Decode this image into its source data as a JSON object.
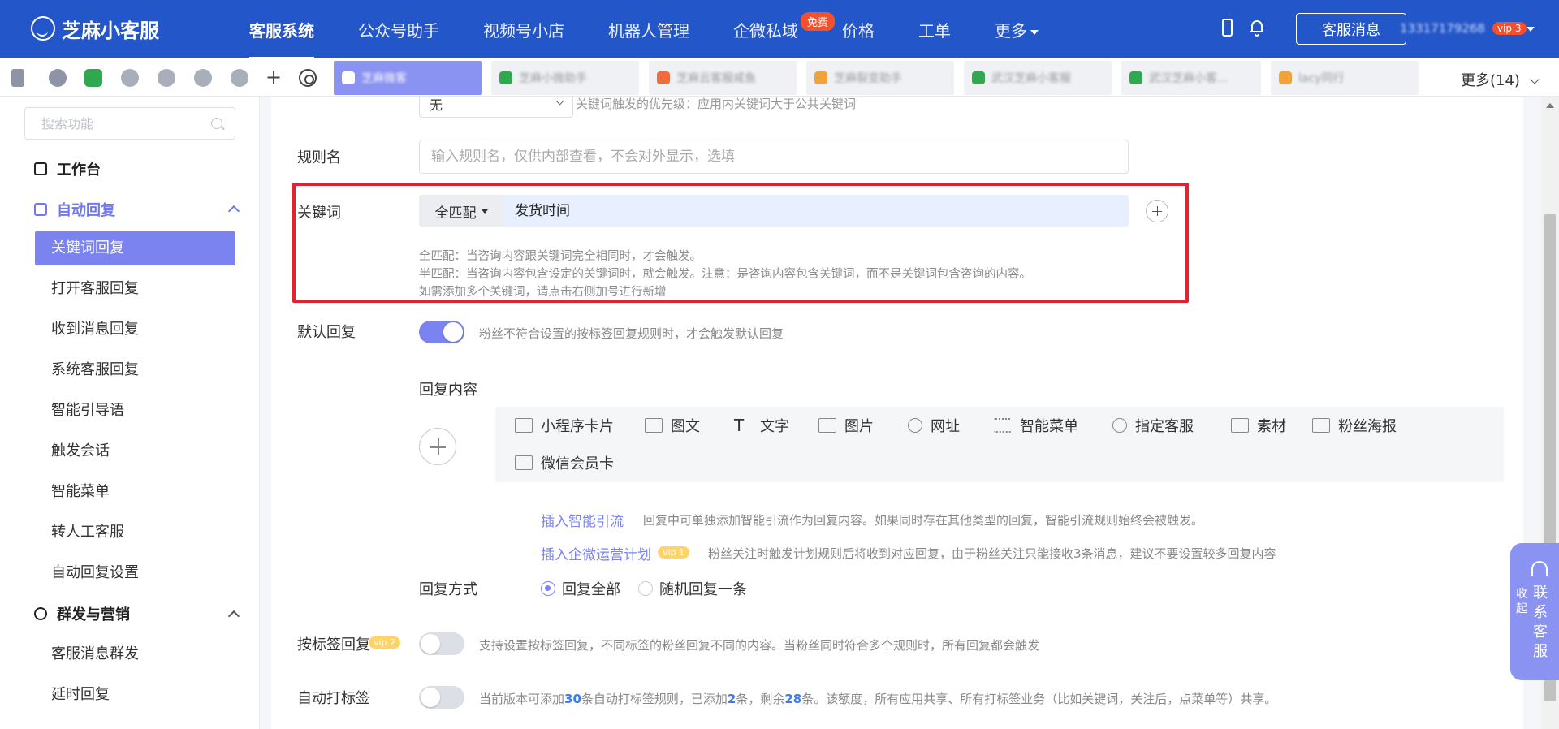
{
  "topbar": {
    "logo": "芝麻小客服",
    "nav": [
      "客服系统",
      "公众号助手",
      "视频号小店",
      "机器人管理",
      "企微私域",
      "价格",
      "工单",
      "更多"
    ],
    "free_badge": "免费",
    "cs_message_button": "客服消息",
    "account": "13317179268",
    "vip_badge": "vip 3",
    "color_primary": "#2356c8"
  },
  "tabs": {
    "items": [
      "芝麻微客",
      "芝麻小微助手",
      "芝麻云客服咸鱼",
      "芝麻裂变助手",
      "武汉芝麻小客服",
      "武汉芝麻小客...",
      "lacy同行"
    ],
    "more": "更多(14)"
  },
  "sidebar": {
    "search_placeholder": "搜索功能",
    "workbench": "工作台",
    "auto_reply": "自动回复",
    "auto_reply_items": [
      "关键词回复",
      "打开客服回复",
      "收到消息回复",
      "系统客服回复",
      "智能引导语",
      "触发会话",
      "智能菜单",
      "转人工客服",
      "自动回复设置"
    ],
    "marketing": "群发与营销",
    "marketing_items": [
      "客服消息群发",
      "延时回复"
    ],
    "active_color": "#7a83f0"
  },
  "form": {
    "top_select_value": "无",
    "top_hint": "关键词触发的优先级：应用内关键词大于公共关键词",
    "rule_name_label": "规则名",
    "rule_name_placeholder": "输入规则名，仅供内部查看，不会对外显示，选填",
    "keyword_label": "关键词",
    "match_type": "全匹配",
    "keyword_value": "发货时间",
    "hints": [
      "全匹配：当咨询内容跟关键词完全相同时，才会触发。",
      "半匹配：当咨询内容包含设定的关键词时，就会触发。注意：是咨询内容包含关键词，而不是关键词包含咨询的内容。",
      "如需添加多个关键词，请点击右侧加号进行新增"
    ],
    "default_reply_label": "默认回复",
    "default_reply_hint": "粉丝不符合设置的按标签回复规则时，才会触发默认回复",
    "reply_content_label": "回复内容",
    "reply_types": [
      "小程序卡片",
      "图文",
      "文字",
      "图片",
      "网址",
      "智能菜单",
      "指定客服",
      "素材",
      "粉丝海报",
      "微信会员卡"
    ],
    "insert_smart_link": "插入智能引流",
    "insert_smart_hint": "回复中可单独添加智能引流作为回复内容。如果同时存在其他类型的回复，智能引流规则始终会被触发。",
    "insert_plan_link": "插入企微运营计划",
    "insert_plan_vip": "vip 1",
    "insert_plan_hint": "粉丝关注时触发计划规则后将收到对应回复，由于粉丝关注只能接收3条消息，建议不要设置较多回复内容",
    "reply_mode_label": "回复方式",
    "reply_mode_options": [
      "回复全部",
      "随机回复一条"
    ],
    "tag_reply_label": "按标签回复",
    "tag_reply_vip": "vip 2",
    "tag_reply_hint": "支持设置按标签回复，不同标签的粉丝回复不同的内容。当粉丝同时符合多个规则时，所有回复都会触发",
    "auto_tag_label": "自动打标签",
    "auto_tag_hint_1": "当前版本可添加",
    "auto_tag_total": "30",
    "auto_tag_hint_2": "条自动打标签规则，已添加",
    "auto_tag_added": "2",
    "auto_tag_hint_3": "条，剩余",
    "auto_tag_remaining": "28",
    "auto_tag_hint_4": "条。该额度，所有应用共享、所有打标签业务（比如关键词，关注后，点菜单等）共享。",
    "highlight_color": "#e0242f"
  },
  "float": {
    "collapse": "收起",
    "contact": "联系客服"
  }
}
